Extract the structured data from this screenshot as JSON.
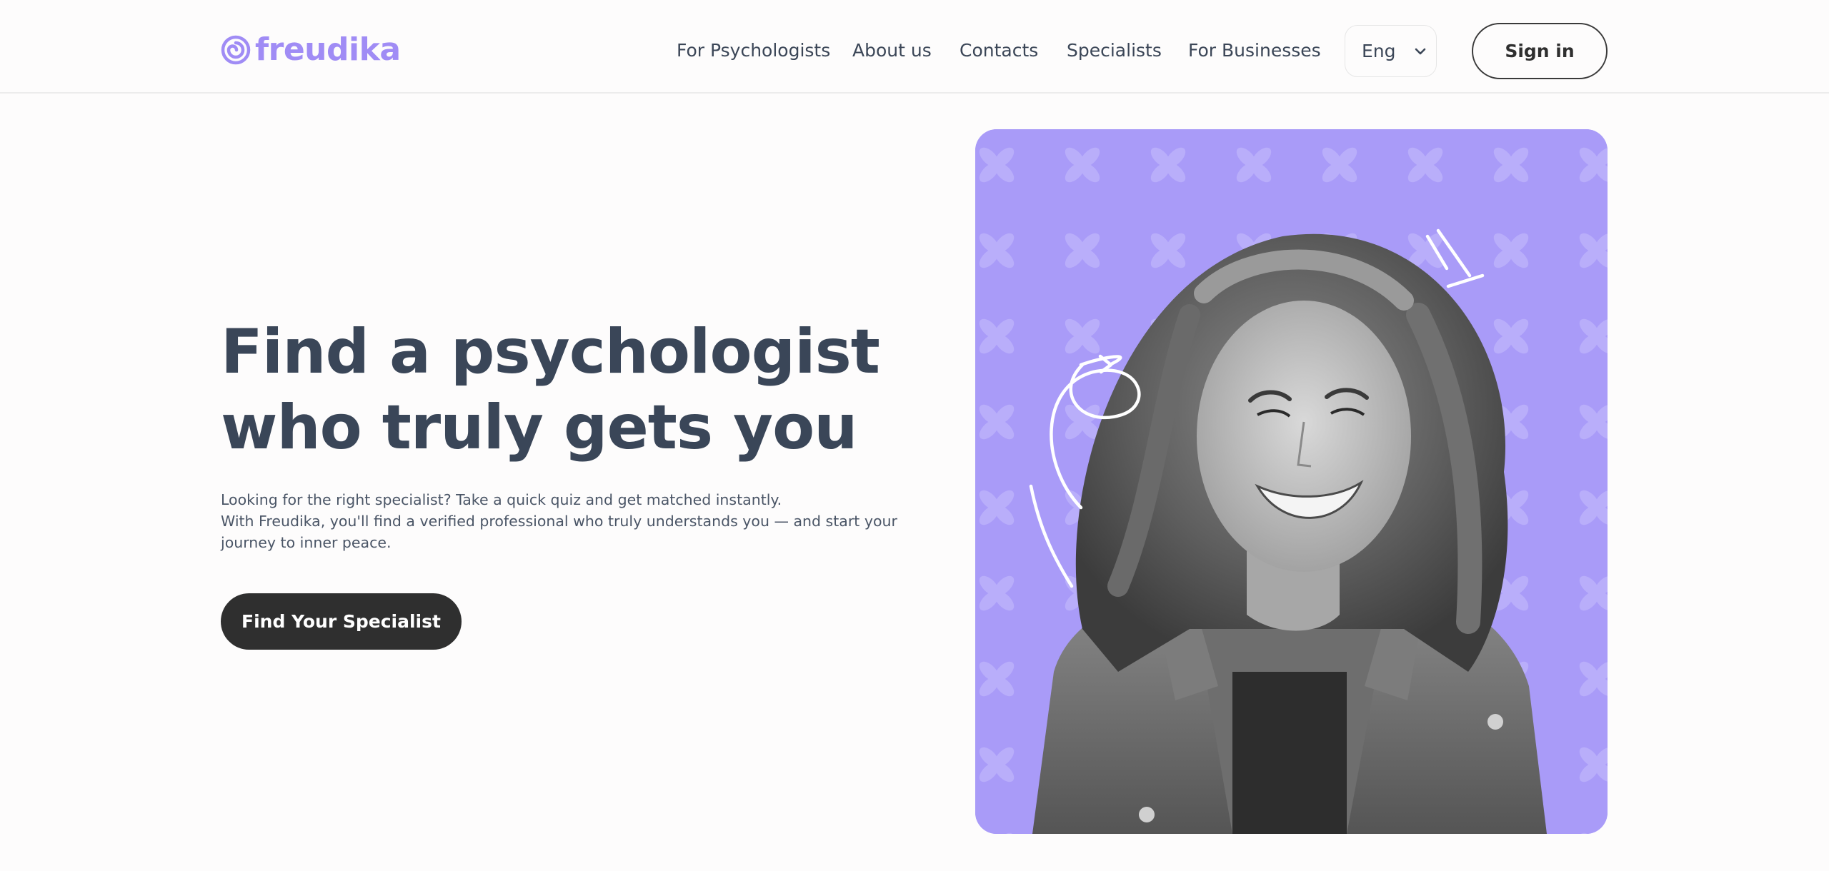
{
  "brand": {
    "name": "freudika",
    "logo_icon": "spiral-icon",
    "accent_color": "#a08cf5"
  },
  "nav": {
    "items": [
      {
        "label": "For Psychologists"
      },
      {
        "label": "About us"
      },
      {
        "label": "Contacts"
      },
      {
        "label": "Specialists"
      },
      {
        "label": "For Businesses"
      }
    ],
    "language": {
      "selected": "Eng",
      "icon": "chevron-down-icon"
    },
    "signin_label": "Sign in"
  },
  "hero": {
    "title_lines": [
      "Find a psychologist",
      "who truly gets you"
    ],
    "description_lines": [
      "Looking for the right specialist? Take a quick quiz and get matched instantly.",
      "With Freudika, you'll find a verified professional who truly understands you — and start your",
      "journey to inner peace."
    ],
    "cta_label": "Find Your Specialist",
    "cta_color": "#2f2f2f"
  },
  "photo": {
    "background_color": "#a99bf8",
    "pattern": "four-petal-flower-icon",
    "subject": "smiling woman portrait"
  }
}
